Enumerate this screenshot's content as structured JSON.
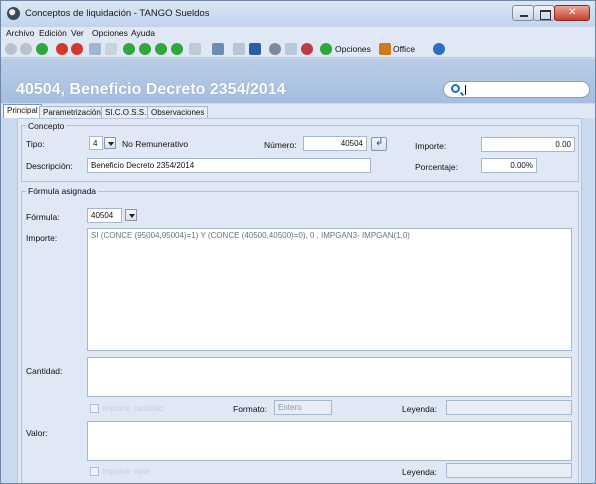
{
  "window": {
    "title": "Conceptos de liquidación - TANGO Sueldos"
  },
  "menu": [
    "Archivo",
    "Edición",
    "Ver",
    "Opciones",
    "Ayuda"
  ],
  "toolbar": {
    "opciones_label": "Opciones",
    "office_label": "Office"
  },
  "header": {
    "title": "40504, Beneficio Decreto 2354/2014",
    "search_value": ""
  },
  "tabs": [
    "Principal",
    "Parametrización",
    "SI.C.O.S.S.",
    "Observaciones"
  ],
  "concepto": {
    "legend": "Concepto",
    "tipo_label": "Tipo:",
    "tipo_value": "4",
    "tipo_desc": "No Remunerativo",
    "numero_label": "Número:",
    "numero_value": "40504",
    "importe_label": "Importe:",
    "importe_value": "0.00",
    "descripcion_label": "Descripción:",
    "descripcion_value": "Beneficio Decreto 2354/2014",
    "porcentaje_label": "Porcentaje:",
    "porcentaje_value": "0.00%"
  },
  "formula": {
    "legend": "Fórmula asignada",
    "formula_label": "Fórmula:",
    "formula_value": "40504",
    "importe_label": "Importe:",
    "importe_expr": "SI (CONCE (95004,95004)=1) Y (CONCE (40500,40500)=0), 0 , IMPGAN3- IMPGAN(1,0)",
    "cantidad_label": "Cantidad:",
    "imprimir_cantidad": "Imprimir cantidad",
    "formato_label": "Formato:",
    "formato_value": "Entero",
    "leyenda_label": "Leyenda:",
    "valor_label": "Valor:",
    "imprimir_valor": "Imprimir valor",
    "leyenda2_label": "Leyenda:"
  }
}
